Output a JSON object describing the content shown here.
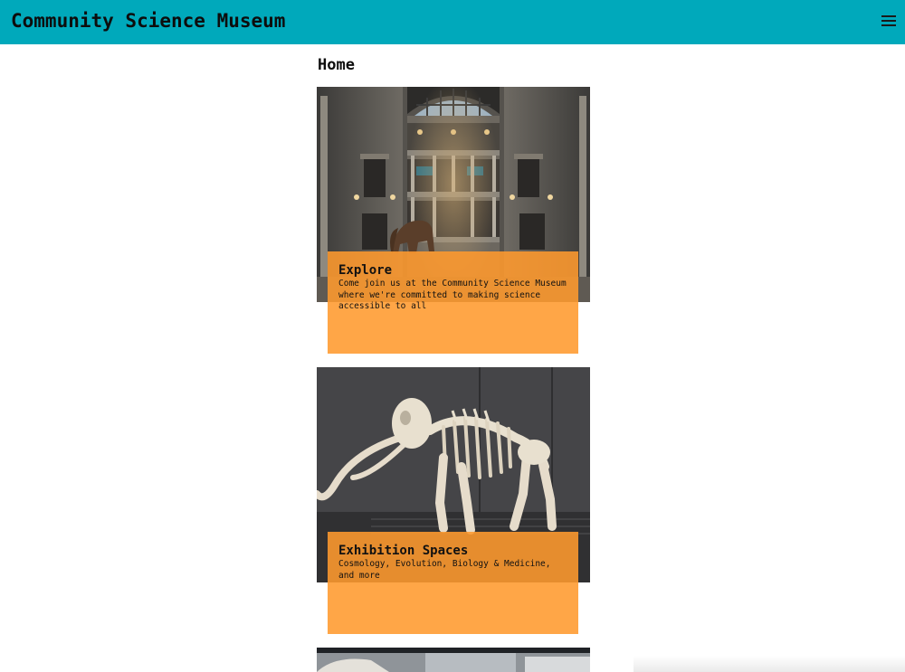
{
  "header": {
    "site_title": "Community Science Museum",
    "background_color": "#00a9bb",
    "menu_icon": "hamburger-menu-icon"
  },
  "main": {
    "page_title": "Home",
    "cards": [
      {
        "title": "Explore",
        "description": "Come join us at the Community Science Museum where we're committed to making science accessible to all",
        "image_subject": "museum-rotunda-photo"
      },
      {
        "title": "Exhibition Spaces",
        "description": "Cosmology, Evolution, Biology & Medicine, and more",
        "image_subject": "mammoth-skeleton-photo"
      },
      {
        "image_subject": "exhibit-photo"
      }
    ],
    "caption_color": "#ff9a2e"
  }
}
